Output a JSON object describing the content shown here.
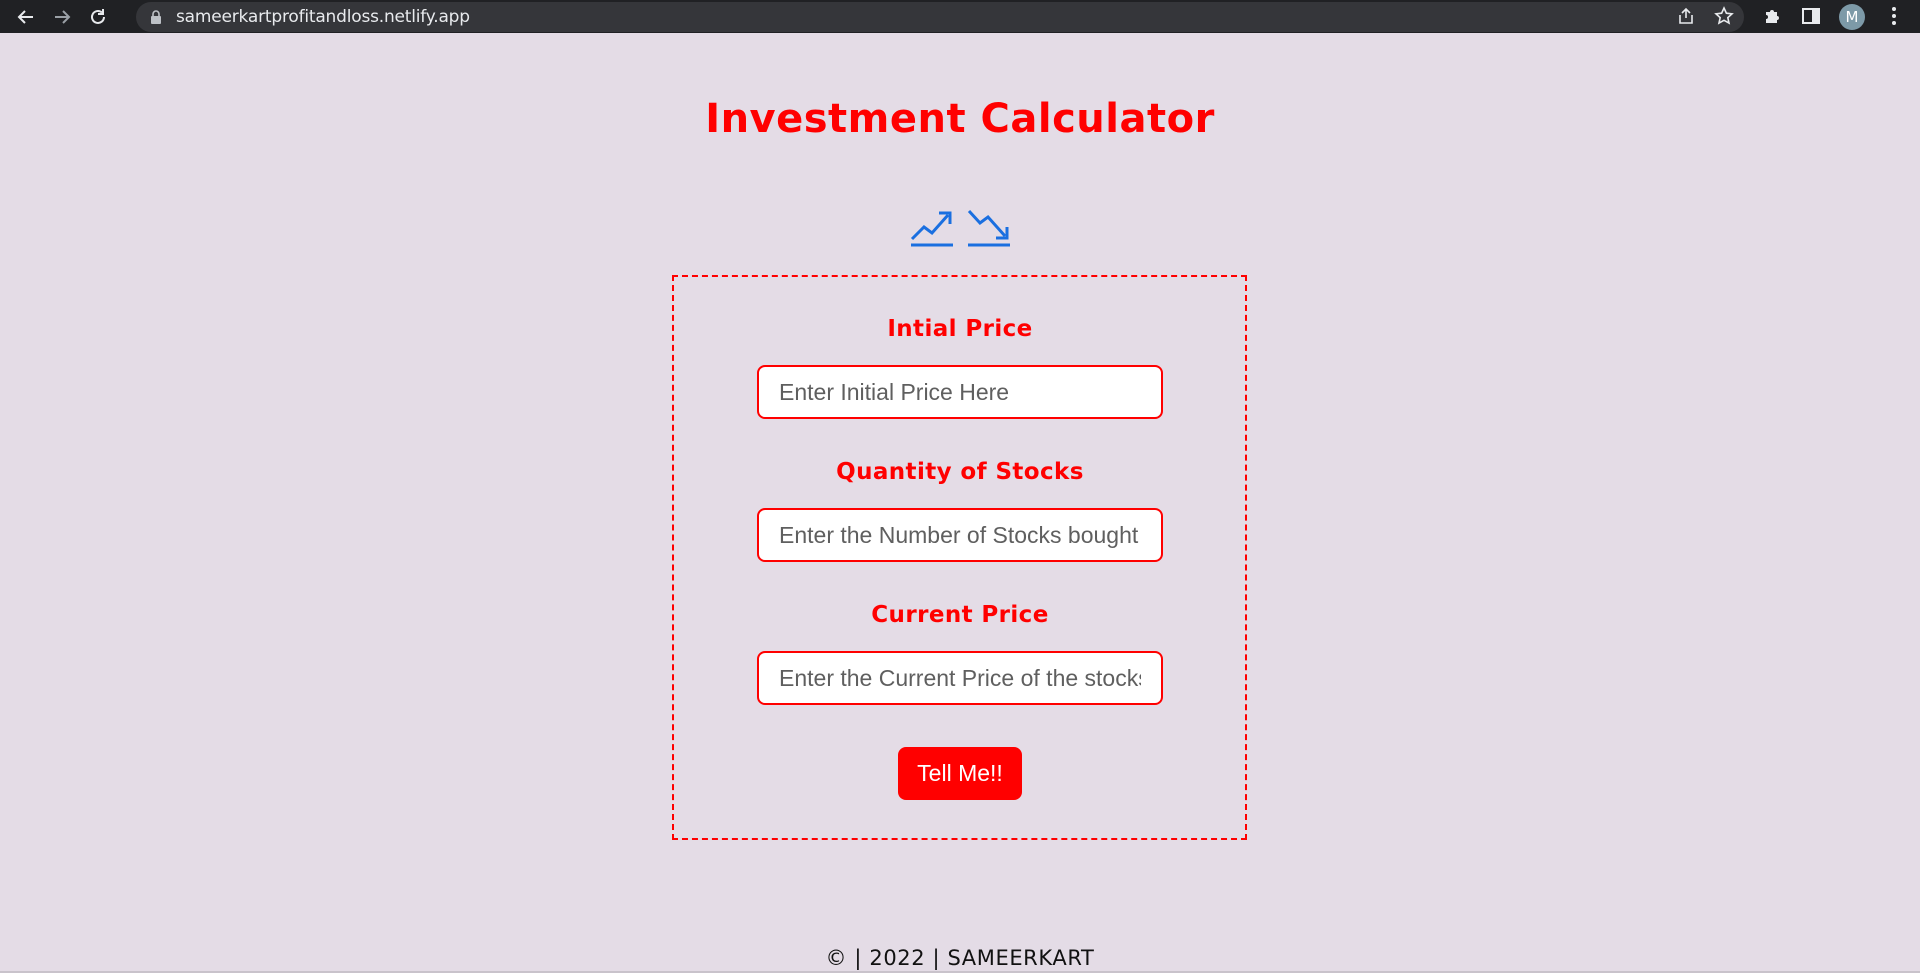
{
  "browser": {
    "url": "sameerkartprofitandloss.netlify.app",
    "profile_initial": "M",
    "icons": [
      "back-icon",
      "forward-icon",
      "reload-icon",
      "lock-icon",
      "share-icon",
      "star-icon",
      "extensions-icon",
      "side-panel-icon",
      "menu-icon"
    ]
  },
  "page": {
    "title": "Investment Calculator",
    "icons": [
      "trending-up-icon",
      "trending-down-icon"
    ],
    "form": {
      "initial_price": {
        "label": "Intial Price",
        "placeholder": "Enter Initial Price Here",
        "value": ""
      },
      "quantity": {
        "label": "Quantity of Stocks",
        "placeholder": "Enter the Number of Stocks bought",
        "value": ""
      },
      "current_price": {
        "label": "Current Price",
        "placeholder": "Enter the Current Price of the stocks",
        "value": ""
      },
      "submit_label": "Tell Me!!"
    },
    "footer": "© | 2022 | SAMEERKART"
  },
  "colors": {
    "accent": "#ff0000",
    "background": "#e4dce6",
    "icon_blue": "#1a6fe0"
  }
}
